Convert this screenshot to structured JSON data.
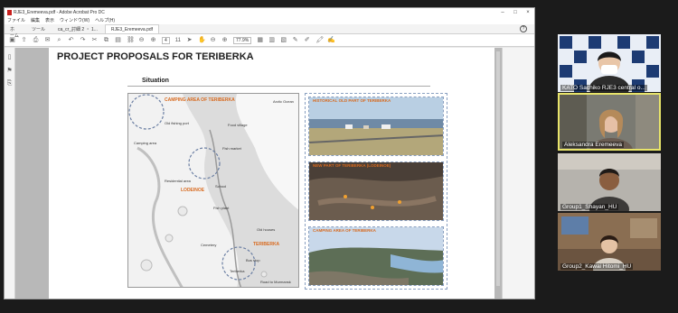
{
  "window": {
    "title": "RJE3_Eremeeva.pdf - Adobe Acrobat Pro DC",
    "menu": [
      "ファイル",
      "編集",
      "表示",
      "ウィンドウ(W)",
      "ヘルプ(H)"
    ],
    "controls": [
      "–",
      "□",
      "×"
    ]
  },
  "tabs": [
    {
      "label": "ホーム"
    },
    {
      "label": "ツール"
    },
    {
      "label": "ca_cr_討細 2 ・ 1..."
    },
    {
      "label": "RJE3_Eremeeva.pdf"
    }
  ],
  "toolbar": {
    "page_current": "4",
    "page_total": "11",
    "zoom": "77.9%"
  },
  "page": {
    "title": "PROJECT PROPOSALS FOR TERIBERKA",
    "section": "Situation"
  },
  "map": {
    "labels": {
      "camping": "CAMPING AREA OF TERIBERKA",
      "lodeinoe": "LODEINOE",
      "teriberka": "TERIBERKA",
      "arctic": "Arctic Ocean",
      "old_fishing": "Old fishing port",
      "camping_area": "Camping area",
      "food_village": "Food village",
      "fish_market": "Fish market",
      "residential": "Residential area",
      "school": "School",
      "fish_plant": "Fish plant",
      "old_houses": "Old houses",
      "cemetery": "Cemetery",
      "teriberka_village": "Teriberka",
      "bus_stop": "Bus stop",
      "road": "Road to Murmansk"
    }
  },
  "photos": [
    {
      "caption": "HISTORICAL OLD PART OF TERIBERKA"
    },
    {
      "caption": "NEW PART OF TERIBERKA (LODEINOE)"
    },
    {
      "caption": "CAMPING AREA OF TERIBERKA"
    }
  ],
  "participants": [
    {
      "name": "KATO Sachiko RJE3 central o..."
    },
    {
      "name": "Aleksandra Eremeeva"
    },
    {
      "name": "Group1_Shayan_HU"
    },
    {
      "name": "Group2_Kawai Hitomi_HU"
    }
  ],
  "colors": {
    "accent_orange": "#d86a1f",
    "active_speaker": "#e8e46a",
    "app_background": "#1b1b1b"
  }
}
